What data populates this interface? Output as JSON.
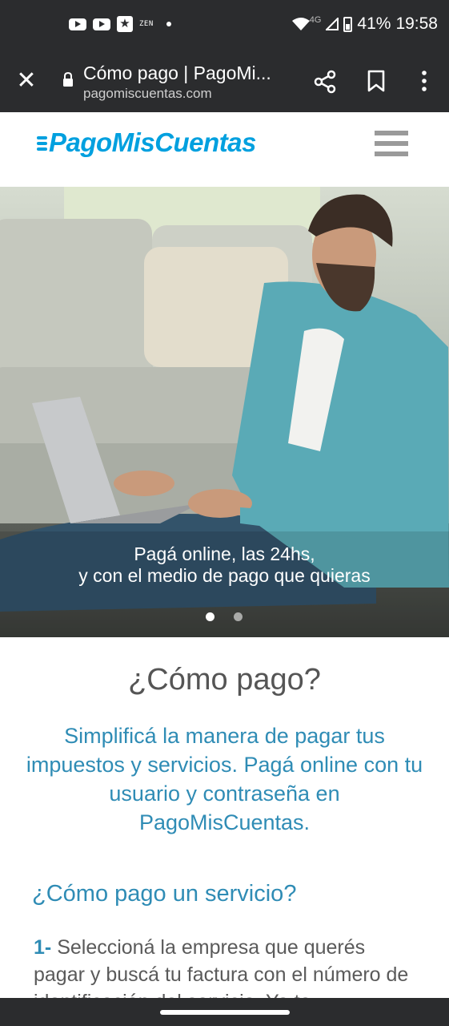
{
  "status_bar": {
    "icons": [
      "youtube-icon",
      "youtube-icon",
      "star-app-icon",
      "zen-icon",
      "notification-dot-icon"
    ],
    "zen_label": "ZEN",
    "network": "4G",
    "battery": "41%",
    "time": "19:58"
  },
  "browser": {
    "page_title": "Cómo pago | PagoMi...",
    "url": "pagomiscuentas.com"
  },
  "site": {
    "logo": "PagoMisCuentas",
    "brand_color": "#00a0df"
  },
  "hero": {
    "caption_line1": "Pagá online, las 24hs,",
    "caption_line2": "y con el medio de pago que quieras",
    "slides": 2,
    "active_slide": 1
  },
  "content": {
    "heading": "¿Cómo pago?",
    "lead": "Simplificá la manera de pagar tus impuestos y servicios. Pagá online con tu usuario y contraseña en PagoMisCuentas.",
    "subheading": "¿Cómo pago un servicio?",
    "step1_number": "1-",
    "step1_text": "Seleccioná la empresa que querés pagar y buscá tu factura con el número de identificación del servicio. Ya te"
  },
  "colors": {
    "accent": "#2f8cb5",
    "chrome": "#2b2c2e"
  }
}
